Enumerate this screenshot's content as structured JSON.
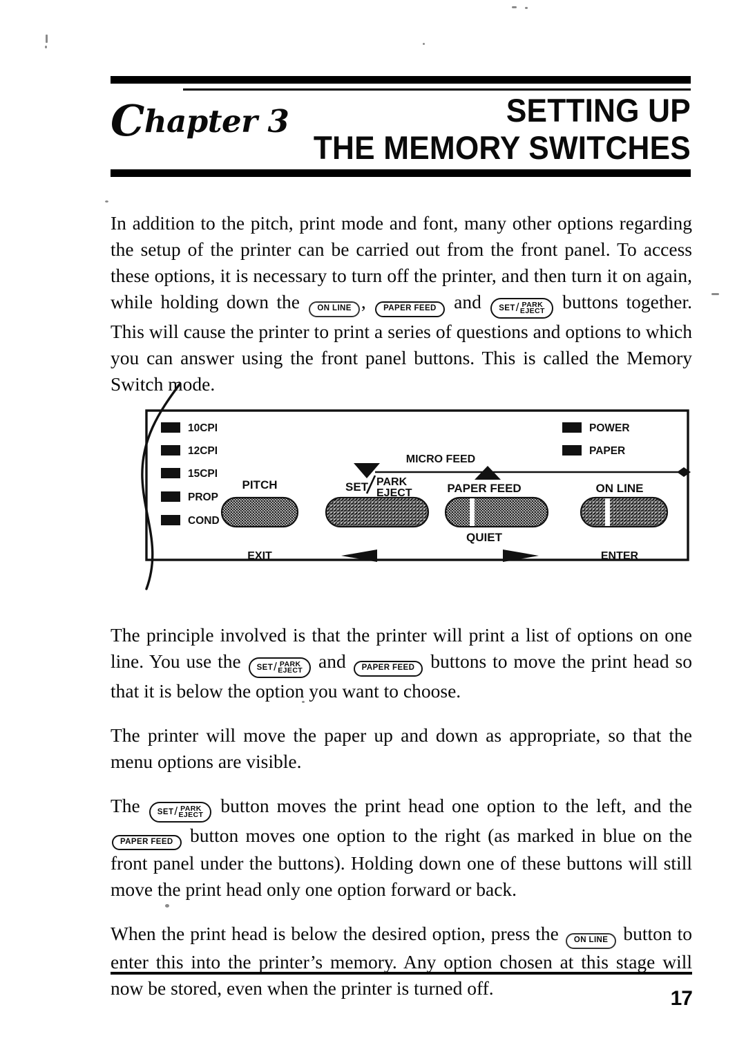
{
  "document": {
    "page_number": "17"
  },
  "header": {
    "chapter_label_prefix": "C",
    "chapter_label_rest": "hapter 3",
    "title_line1": "SETTING UP",
    "title_line2": "THE MEMORY SWITCHES"
  },
  "buttons": {
    "on_line": "ON LINE",
    "paper_feed": "PAPER FEED",
    "set": "SET",
    "slash": "/",
    "park": "PARK",
    "eject": "EJECT"
  },
  "paragraphs": {
    "p1_a": "In addition to the pitch, print mode and font, many other options regarding the setup of the printer can be carried out from the front panel. To access these options, it is necessary to turn off the printer, and then turn it on again, while holding down the ",
    "p1_b": ", ",
    "p1_c": " and ",
    "p1_d": " buttons together. This will cause the printer to print a series of questions and options to which you can answer using the front panel buttons. This is called the Memory Switch mode.",
    "p2_a": "The principle involved is that the printer will print a list of options on one line. You use the ",
    "p2_b": " and ",
    "p2_c": " buttons to move the print head so that it is below the option you want to choose.",
    "p3": "The printer will move the paper up and down as appropriate, so that the menu options are visible.",
    "p4_a": "The ",
    "p4_b": " button moves the print head one option to the left, and the ",
    "p4_c": " button moves one option to the right (as marked in blue on the front panel under the buttons). Holding down one of these buttons will still move the print head only one option forward or back.",
    "p5_a": "When the print head is below the desired option, press the ",
    "p5_b": " button to enter this into the printer’s memory. Any option chosen at this stage will now be stored, even when the printer is turned off."
  },
  "panel": {
    "indicators_left": [
      {
        "label": "10CPI"
      },
      {
        "label": "12CPI"
      },
      {
        "label": "15CPI"
      },
      {
        "label": "PROP"
      },
      {
        "label": "COND"
      }
    ],
    "indicators_right": [
      {
        "label": "POWER"
      },
      {
        "label": "PAPER"
      }
    ],
    "micro_feed_label": "MICRO FEED",
    "quiet_label": "QUIET",
    "button_labels": {
      "pitch": "PITCH",
      "set": "SET",
      "slash": "/",
      "park": "PARK",
      "eject": "EJECT",
      "paper_feed": "PAPER FEED",
      "on_line": "ON LINE"
    },
    "blue_labels": {
      "exit": "EXIT",
      "left_arrow": "◀",
      "right_arrow": "▶",
      "enter": "ENTER"
    }
  },
  "colors": {
    "ink": "#0a0a0a",
    "paper": "#ffffff",
    "button_fill": "#8f8f8f"
  }
}
